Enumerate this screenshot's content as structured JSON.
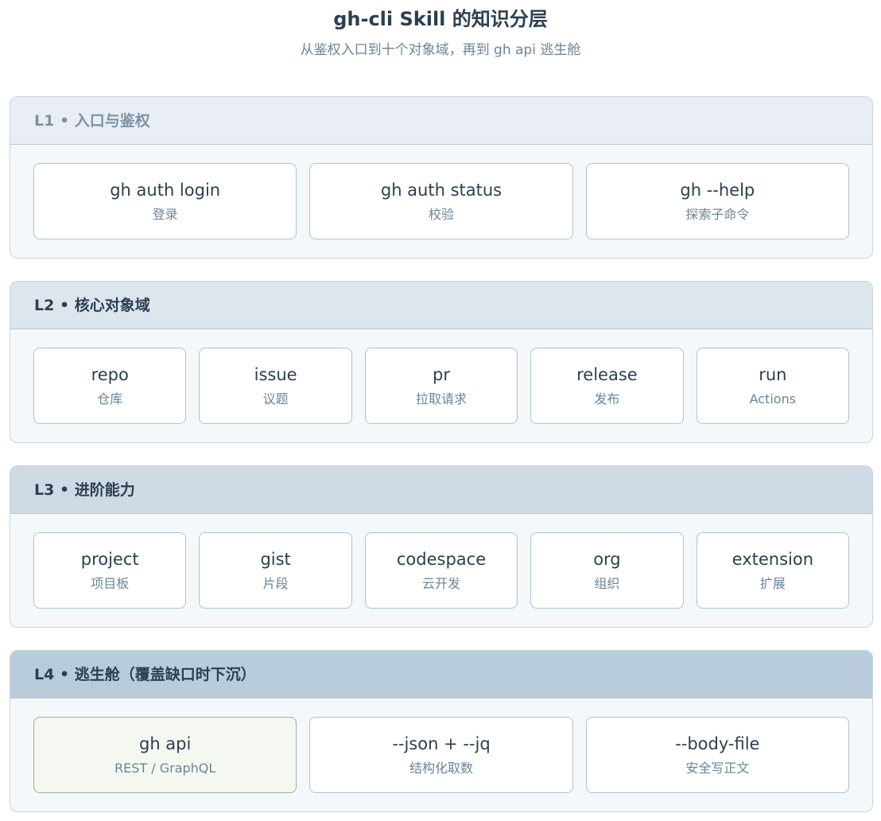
{
  "title": "gh-cli Skill 的知识分层",
  "subtitle": "从鉴权入口到十个对象域，再到 gh api 逃生舱",
  "layers": [
    {
      "label": "L1 • 入口与鉴权",
      "header_bg": "#e8eef3",
      "header_color": "#7d93a5",
      "items": [
        {
          "title": "gh auth login",
          "sub": "登录"
        },
        {
          "title": "gh auth status",
          "sub": "校验"
        },
        {
          "title": "gh --help",
          "sub": "探索子命令"
        }
      ]
    },
    {
      "label": "L2 • 核心对象域",
      "header_bg": "#dde6ed",
      "header_color": "#2c3e50",
      "items": [
        {
          "title": "repo",
          "sub": "仓库"
        },
        {
          "title": "issue",
          "sub": "议题"
        },
        {
          "title": "pr",
          "sub": "拉取请求"
        },
        {
          "title": "release",
          "sub": "发布"
        },
        {
          "title": "run",
          "sub": "Actions"
        }
      ]
    },
    {
      "label": "L3 • 进阶能力",
      "header_bg": "#cdd9e3",
      "header_color": "#2c3e50",
      "items": [
        {
          "title": "project",
          "sub": "项目板"
        },
        {
          "title": "gist",
          "sub": "片段"
        },
        {
          "title": "codespace",
          "sub": "云开发"
        },
        {
          "title": "org",
          "sub": "组织"
        },
        {
          "title": "extension",
          "sub": "扩展"
        }
      ]
    },
    {
      "label": "L4 • 逃生舱（覆盖缺口时下沉）",
      "header_bg": "#b9ccdb",
      "header_color": "#2c3e50",
      "items": [
        {
          "title": "gh api",
          "sub": "REST / GraphQL",
          "accent": true
        },
        {
          "title": "--json + --jq",
          "sub": "结构化取数"
        },
        {
          "title": "--body-file",
          "sub": "安全写正文"
        }
      ]
    }
  ]
}
